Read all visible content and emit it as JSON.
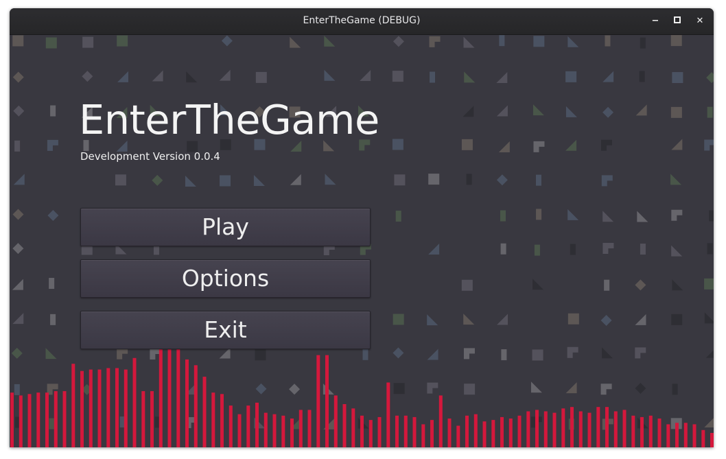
{
  "window": {
    "title": "EnterTheGame (DEBUG)",
    "controls": {
      "minimize": "−",
      "maximize": "▫",
      "close": "✕"
    }
  },
  "main": {
    "game_title": "EnterTheGame",
    "version": "Development Version 0.0.4",
    "buttons": {
      "play": "Play",
      "options": "Options",
      "exit": "Exit"
    }
  },
  "theme": {
    "background": "#393840",
    "visualizer_bar": "#d4183c",
    "tile_colors": [
      "#58555f",
      "#625b58",
      "#4c5566",
      "#4b5a4a",
      "#6b6a70",
      "#2e2d33"
    ]
  },
  "visualizer": {
    "levels": [
      0.38,
      0.36,
      0.37,
      0.38,
      0.38,
      0.39,
      0.39,
      0.58,
      0.53,
      0.54,
      0.54,
      0.55,
      0.55,
      0.54,
      0.62,
      0.39,
      0.39,
      0.68,
      0.68,
      0.68,
      0.61,
      0.57,
      0.49,
      0.38,
      0.37,
      0.29,
      0.23,
      0.29,
      0.31,
      0.24,
      0.23,
      0.22,
      0.2,
      0.26,
      0.26,
      0.64,
      0.64,
      0.36,
      0.3,
      0.27,
      0.22,
      0.19,
      0.21,
      0.45,
      0.22,
      0.22,
      0.21,
      0.16,
      0.19,
      0.36,
      0.2,
      0.15,
      0.22,
      0.23,
      0.18,
      0.19,
      0.21,
      0.2,
      0.22,
      0.25,
      0.26,
      0.25,
      0.24,
      0.27,
      0.28,
      0.25,
      0.24,
      0.28,
      0.28,
      0.25,
      0.26,
      0.22,
      0.21,
      0.22,
      0.2,
      0.16,
      0.17,
      0.17,
      0.16,
      0.12,
      0.1,
      0.08,
      0.06,
      0.05,
      0.05
    ]
  }
}
